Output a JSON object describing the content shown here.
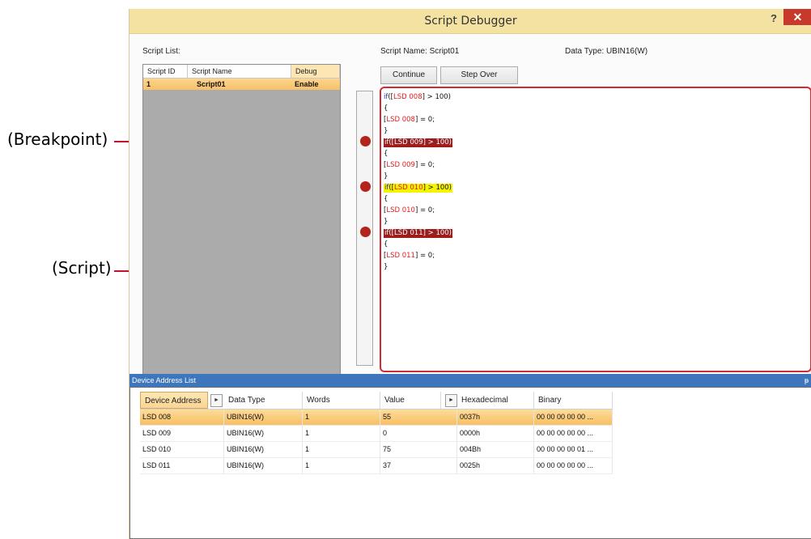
{
  "callouts": {
    "breakpoint": "(Breakpoint)",
    "script": "(Script)"
  },
  "window": {
    "title": "Script Debugger",
    "help": "?",
    "close": "✕"
  },
  "labels": {
    "script_list": "Script List:",
    "script_name": "Script Name: Script01",
    "data_type": "Data Type: UBIN16(W)"
  },
  "buttons": {
    "continue": "Continue",
    "step_over": "Step Over"
  },
  "script_list": {
    "columns": [
      "Script ID",
      "Script Name",
      "Debug"
    ],
    "rows": [
      {
        "id": "1",
        "name": "Script01",
        "debug": "Enable"
      }
    ]
  },
  "code": {
    "lines": [
      {
        "t": "if",
        "a": "([",
        "d": "LSD 008",
        "b": "] > 100)",
        "hl": ""
      },
      {
        "t": "",
        "a": "{",
        "d": "",
        "b": "",
        "hl": ""
      },
      {
        "t": "",
        "a": "[",
        "d": "LSD 008",
        "b": "] = 0;",
        "hl": ""
      },
      {
        "t": "",
        "a": "}",
        "d": "",
        "b": "",
        "hl": ""
      },
      {
        "t": "if",
        "a": "([",
        "d": "LSD 009",
        "b": "] > 100)",
        "hl": "red"
      },
      {
        "t": "",
        "a": "{",
        "d": "",
        "b": "",
        "hl": ""
      },
      {
        "t": "",
        "a": "[",
        "d": "LSD 009",
        "b": "] = 0;",
        "hl": ""
      },
      {
        "t": "",
        "a": "}",
        "d": "",
        "b": "",
        "hl": ""
      },
      {
        "t": "if",
        "a": "([",
        "d": "LSD 010",
        "b": "] > 100)",
        "hl": "yellow"
      },
      {
        "t": "",
        "a": "{",
        "d": "",
        "b": "",
        "hl": ""
      },
      {
        "t": "",
        "a": "[",
        "d": "LSD 010",
        "b": "] = 0;",
        "hl": ""
      },
      {
        "t": "",
        "a": "}",
        "d": "",
        "b": "",
        "hl": ""
      },
      {
        "t": "if",
        "a": "([",
        "d": "LSD 011",
        "b": "] > 100)",
        "hl": "red"
      },
      {
        "t": "",
        "a": "{",
        "d": "",
        "b": "",
        "hl": ""
      },
      {
        "t": "",
        "a": "[",
        "d": "LSD 011",
        "b": "] = 0;",
        "hl": ""
      },
      {
        "t": "",
        "a": "}",
        "d": "",
        "b": "",
        "hl": ""
      }
    ],
    "breakpoint_lines": [
      5,
      9,
      13
    ]
  },
  "device_list": {
    "title": "Device Address List",
    "pin": "ᵽ",
    "arrow": "►",
    "columns": [
      "Device Address",
      "Data Type",
      "Words",
      "Value",
      "Hexadecimal",
      "Binary"
    ],
    "rows": [
      [
        "LSD 008",
        "UBIN16(W)",
        "1",
        "55",
        "0037h",
        "00 00 00 00 00 ..."
      ],
      [
        "LSD 009",
        "UBIN16(W)",
        "1",
        "0",
        "0000h",
        "00 00 00 00 00 ..."
      ],
      [
        "LSD 010",
        "UBIN16(W)",
        "1",
        "75",
        "004Bh",
        "00 00 00 00 01 ..."
      ],
      [
        "LSD 011",
        "UBIN16(W)",
        "1",
        "37",
        "0025h",
        "00 00 00 00 00 ..."
      ]
    ]
  },
  "colors": {
    "title_bar": "#f4e2a3",
    "selection": "#f7c16a",
    "callout_line": "#c8102e",
    "breakpoint": "#b4231c"
  }
}
